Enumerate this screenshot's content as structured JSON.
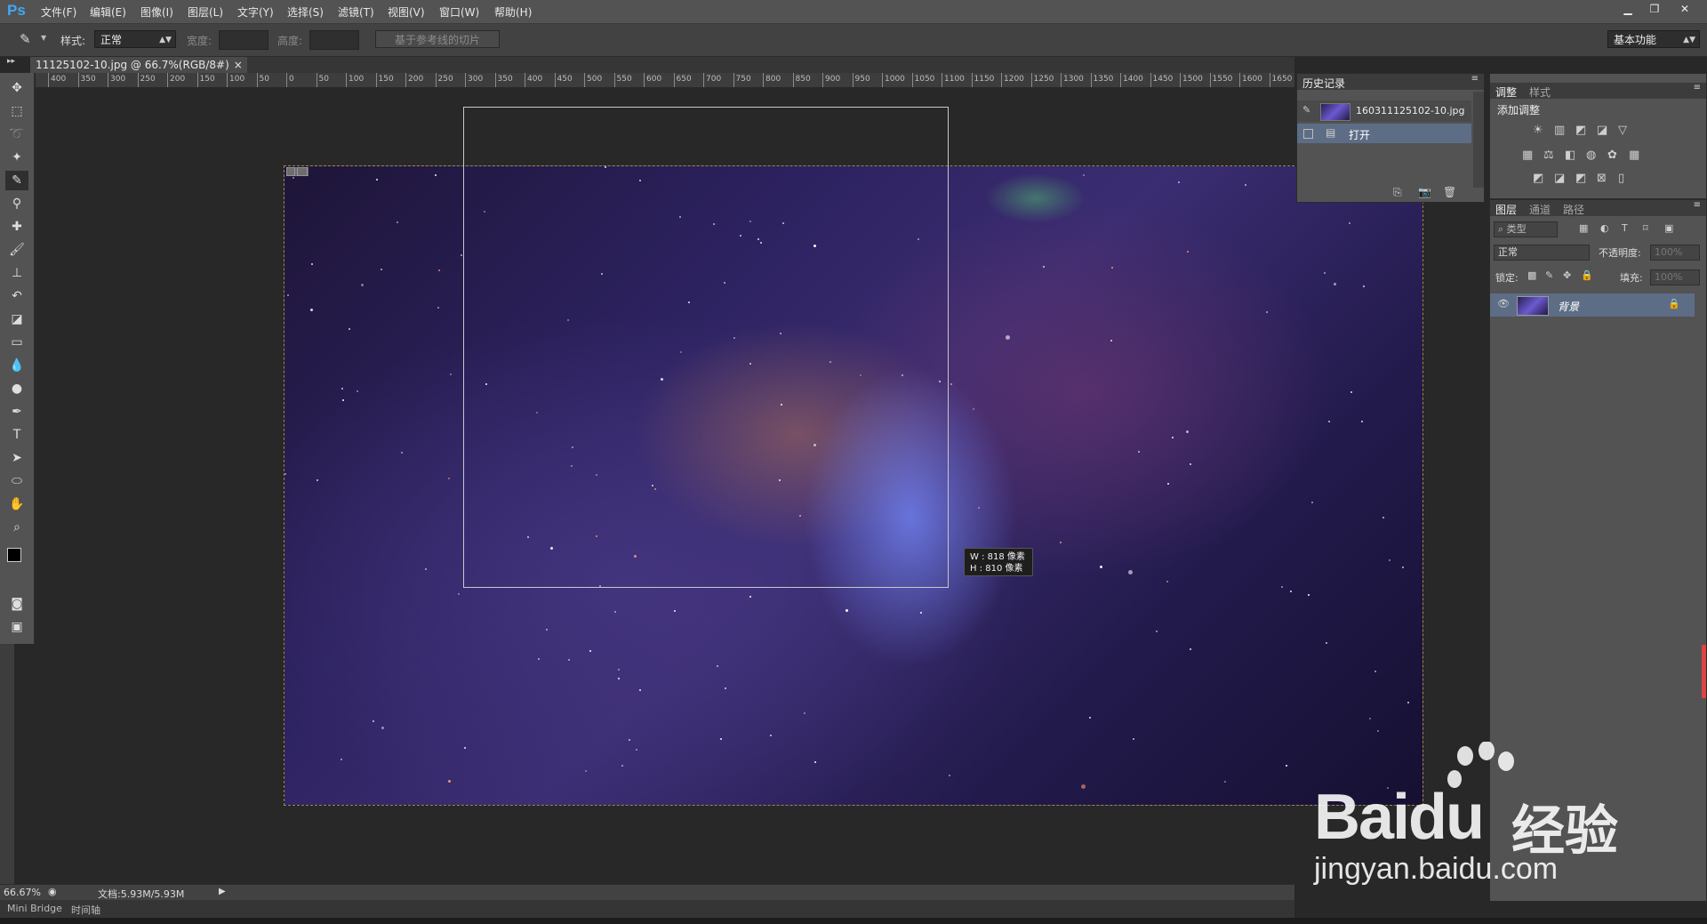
{
  "app": {
    "logo": "Ps",
    "menu": [
      "文件(F)",
      "编辑(E)",
      "图像(I)",
      "图层(L)",
      "文字(Y)",
      "选择(S)",
      "滤镜(T)",
      "视图(V)",
      "窗口(W)",
      "帮助(H)"
    ],
    "window_controls": {
      "minimize": "▁",
      "restore": "❐",
      "close": "✕"
    }
  },
  "options": {
    "style_label": "样式:",
    "style_value": "正常",
    "width_label": "宽度:",
    "height_label": "高度:",
    "slice_button": "基于参考线的切片",
    "workspace": "基本功能"
  },
  "document": {
    "tab_title": "11125102-10.jpg @ 66.7%(RGB/8#)",
    "tab_close": "×",
    "ruler_labels": [
      "400",
      "350",
      "300",
      "250",
      "200",
      "150",
      "100",
      "50",
      "0",
      "50",
      "100",
      "150",
      "200",
      "250",
      "300",
      "350",
      "400",
      "450",
      "500",
      "550",
      "600",
      "650",
      "700",
      "750",
      "800",
      "850",
      "900",
      "950",
      "1000",
      "1050",
      "1100",
      "1150",
      "1200",
      "1250",
      "1300",
      "1350",
      "1400",
      "1450",
      "1500",
      "1550",
      "1600",
      "1650"
    ],
    "size_tip_w": "W : 818 像素",
    "size_tip_h": "H : 810 像素"
  },
  "status": {
    "zoom": "66.67%",
    "doc_info": "文档:5.93M/5.93M",
    "tabs": [
      "Mini Bridge",
      "时间轴"
    ]
  },
  "history_panel": {
    "tab": "历史记录",
    "snapshot_name": "160311125102-10.jpg",
    "step_name": "打开"
  },
  "adjust_panel": {
    "tabs": [
      "调整",
      "样式"
    ],
    "title": "添加调整"
  },
  "layers_panel": {
    "tabs": [
      "图层",
      "通道",
      "路径"
    ],
    "filter_label": "类型",
    "blend_mode": "正常",
    "opacity_label": "不透明度:",
    "opacity_value": "100%",
    "lock_label": "锁定:",
    "fill_label": "填充:",
    "fill_value": "100%",
    "layer_name": "背景"
  },
  "watermark": {
    "brand": "Bai",
    "brand_tail": "du",
    "brand_cn": "经验",
    "url": "jingyan.baidu.com"
  },
  "colors": {
    "accent": "#3fa9f5",
    "panel_bg": "#535353",
    "selected_row": "#5d6d86"
  }
}
